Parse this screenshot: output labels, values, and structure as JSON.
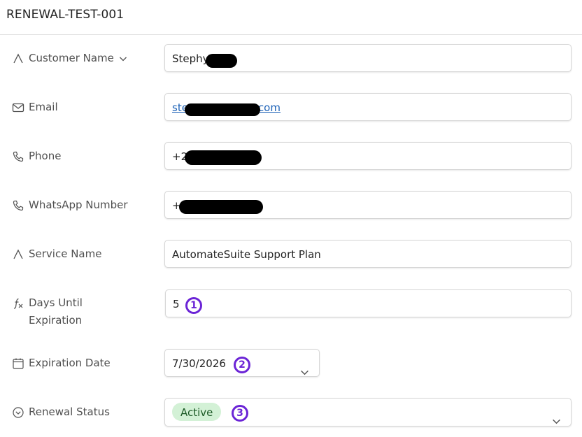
{
  "header": {
    "title": "RENEWAL-TEST-001"
  },
  "fields": {
    "customer_name": {
      "label": "Customer Name",
      "value": "Stephy"
    },
    "email": {
      "label": "Email",
      "value_start": "ste",
      "value_end": "com"
    },
    "phone": {
      "label": "Phone",
      "value": "+2"
    },
    "whatsapp": {
      "label": "WhatsApp Number",
      "value": "+"
    },
    "service_name": {
      "label": "Service Name",
      "value": "AutomateSuite Support Plan"
    },
    "days_until_expiration": {
      "label": "Days Until Expiration",
      "value": "5"
    },
    "expiration_date": {
      "label": "Expiration Date",
      "value": "7/30/2026"
    },
    "renewal_status": {
      "label": "Renewal Status",
      "value": "Active"
    }
  },
  "annotations": [
    "1",
    "2",
    "3"
  ],
  "icons": {
    "customer_name": "text-field-icon",
    "email": "mail-icon",
    "phone": "phone-icon",
    "whatsapp": "phone-icon",
    "service_name": "text-field-icon",
    "days_until_expiration": "formula-icon",
    "expiration_date": "calendar-icon",
    "renewal_status": "choice-icon"
  },
  "colors": {
    "annotation": "#6b24d6",
    "status_pill_bg": "#d3f1d6",
    "link": "#1e63b8"
  }
}
